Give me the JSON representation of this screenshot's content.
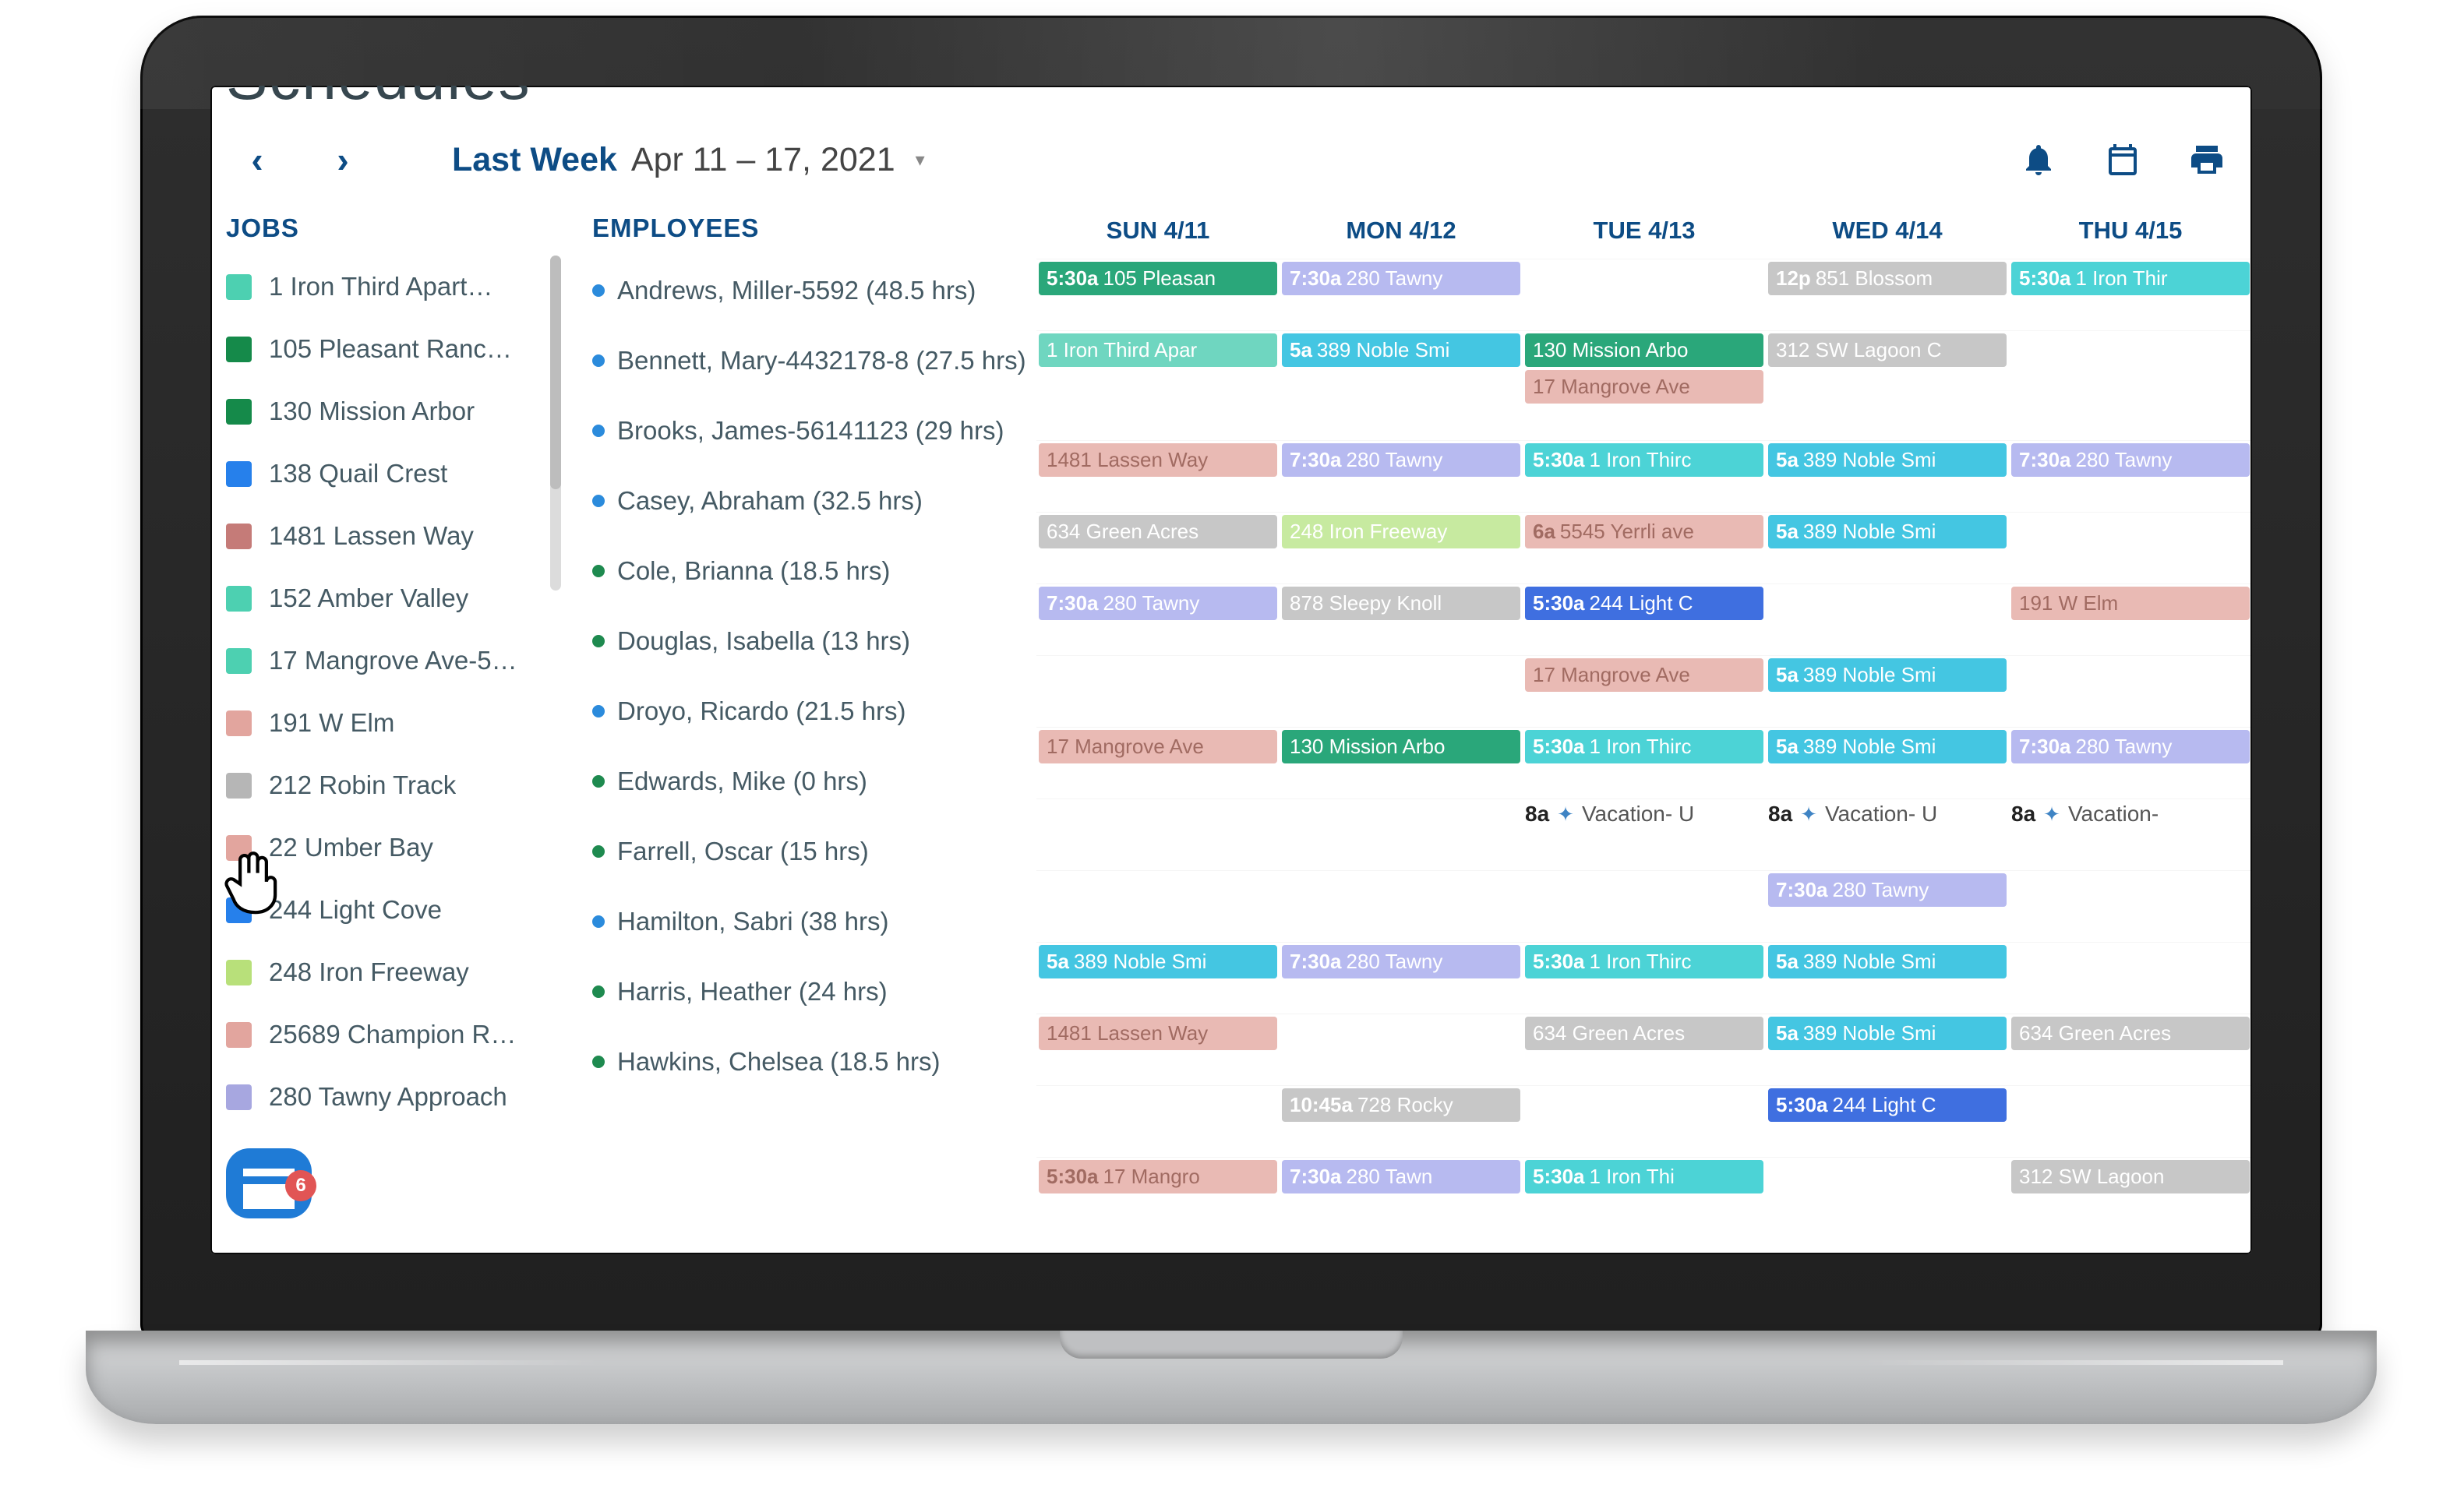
{
  "page": {
    "title": "Schedules"
  },
  "toolbar": {
    "range_label": "Last Week",
    "date_range": "Apr 11 – 17, 2021"
  },
  "day_headers": [
    "SUN 4/11",
    "MON 4/12",
    "TUE 4/13",
    "WED 4/14",
    "THU 4/15"
  ],
  "sections": {
    "jobs": "JOBS",
    "employees": "EMPLOYEES"
  },
  "jobs": [
    {
      "color": "#4dd0b1",
      "name": "1 Iron Third Apart…"
    },
    {
      "color": "#158a4a",
      "name": "105 Pleasant Ranc…"
    },
    {
      "color": "#158a4a",
      "name": "130 Mission Arbor"
    },
    {
      "color": "#2680eb",
      "name": "138 Quail Crest"
    },
    {
      "color": "#c57b78",
      "name": "1481 Lassen Way"
    },
    {
      "color": "#4dd0b1",
      "name": "152 Amber Valley"
    },
    {
      "color": "#4dd0b1",
      "name": "17 Mangrove Ave-5…"
    },
    {
      "color": "#e2a59e",
      "name": "191 W Elm"
    },
    {
      "color": "#b6b6b6",
      "name": "212 Robin Track"
    },
    {
      "color": "#e2a59e",
      "name": "22 Umber Bay"
    },
    {
      "color": "#2680eb",
      "name": "244 Light Cove"
    },
    {
      "color": "#b8e07a",
      "name": "248 Iron Freeway"
    },
    {
      "color": "#e2a59e",
      "name": "25689 Champion R…"
    },
    {
      "color": "#a7a7e0",
      "name": "280 Tawny Approach"
    }
  ],
  "employees": [
    {
      "dot": "#2b8bdc",
      "name": "Andrews, Miller-5592 (48.5 hrs)"
    },
    {
      "dot": "#2b8bdc",
      "name": "Bennett, Mary-4432178-8 (27.5 hrs)"
    },
    {
      "dot": "#2b8bdc",
      "name": "Brooks, James-56141123 (29 hrs)"
    },
    {
      "dot": "#2b8bdc",
      "name": "Casey, Abraham (32.5 hrs)"
    },
    {
      "dot": "#1e8a4f",
      "name": "Cole, Brianna (18.5 hrs)"
    },
    {
      "dot": "#1e8a4f",
      "name": "Douglas, Isabella (13 hrs)"
    },
    {
      "dot": "#2b8bdc",
      "name": "Droyo, Ricardo (21.5 hrs)"
    },
    {
      "dot": "#1e8a4f",
      "name": "Edwards, Mike (0 hrs)"
    },
    {
      "dot": "#1e8a4f",
      "name": "Farrell, Oscar (15 hrs)"
    },
    {
      "dot": "#2b8bdc",
      "name": "Hamilton, Sabri (38 hrs)"
    },
    {
      "dot": "#1e8a4f",
      "name": "Harris, Heather (24 hrs)"
    },
    {
      "dot": "#1e8a4f",
      "name": "Hawkins, Chelsea (18.5 hrs)"
    }
  ],
  "rows": [
    {
      "tall": false,
      "cells": [
        [
          {
            "bg": "#2aa77a",
            "fg": "#ffffff",
            "time": "5:30a",
            "label": "105 Pleasan"
          }
        ],
        [
          {
            "bg": "#b7baf0",
            "fg": "#ffffff",
            "time": "7:30a",
            "label": "280 Tawny"
          }
        ],
        [],
        [
          {
            "bg": "#c7c7c7",
            "fg": "#ffffff",
            "time": "12p",
            "label": "851 Blossom"
          }
        ],
        [
          {
            "bg": "#4cd3d6",
            "fg": "#ffffff",
            "time": "5:30a",
            "label": "1 Iron Thir"
          }
        ]
      ]
    },
    {
      "tall": true,
      "cells": [
        [
          {
            "bg": "#6fd6c0",
            "fg": "#ffffff",
            "time": "",
            "label": "1 Iron Third Apar"
          }
        ],
        [
          {
            "bg": "#44c6e2",
            "fg": "#ffffff",
            "time": "5a",
            "label": "389 Noble Smi"
          }
        ],
        [
          {
            "bg": "#2aa77a",
            "fg": "#ffffff",
            "time": "",
            "label": "130 Mission Arbo"
          },
          {
            "bg": "#e9bab4",
            "fg": "#a16b62",
            "time": "",
            "label": "17 Mangrove Ave"
          }
        ],
        [
          {
            "bg": "#c7c7c7",
            "fg": "#ffffff",
            "time": "",
            "label": "312 SW Lagoon C"
          }
        ],
        []
      ]
    },
    {
      "tall": false,
      "cells": [
        [
          {
            "bg": "#e9bab4",
            "fg": "#a16b62",
            "time": "",
            "label": "1481 Lassen Way"
          }
        ],
        [
          {
            "bg": "#b7baf0",
            "fg": "#ffffff",
            "time": "7:30a",
            "label": "280 Tawny"
          }
        ],
        [
          {
            "bg": "#4cd3d6",
            "fg": "#ffffff",
            "time": "5:30a",
            "label": "1 Iron Thirc"
          }
        ],
        [
          {
            "bg": "#44c6e2",
            "fg": "#ffffff",
            "time": "5a",
            "label": "389 Noble Smi"
          }
        ],
        [
          {
            "bg": "#b7baf0",
            "fg": "#ffffff",
            "time": "7:30a",
            "label": "280 Tawny"
          }
        ]
      ]
    },
    {
      "tall": false,
      "cells": [
        [
          {
            "bg": "#c7c7c7",
            "fg": "#ffffff",
            "time": "",
            "label": "634 Green Acres"
          }
        ],
        [
          {
            "bg": "#c7eaa0",
            "fg": "#ffffff",
            "time": "",
            "label": "248 Iron Freeway"
          }
        ],
        [
          {
            "bg": "#e9bab4",
            "fg": "#a16b62",
            "time": "6a",
            "label": "5545 Yerrli ave"
          }
        ],
        [
          {
            "bg": "#44c6e2",
            "fg": "#ffffff",
            "time": "5a",
            "label": "389 Noble Smi"
          }
        ],
        []
      ]
    },
    {
      "tall": false,
      "cells": [
        [
          {
            "bg": "#b7baf0",
            "fg": "#ffffff",
            "time": "7:30a",
            "label": "280 Tawny"
          }
        ],
        [
          {
            "bg": "#c7c7c7",
            "fg": "#ffffff",
            "time": "",
            "label": "878 Sleepy Knoll"
          }
        ],
        [
          {
            "bg": "#3f6fe0",
            "fg": "#ffffff",
            "time": "5:30a",
            "label": "244 Light C"
          }
        ],
        [],
        [
          {
            "bg": "#e9bab4",
            "fg": "#a16b62",
            "time": "",
            "label": "191 W Elm"
          }
        ]
      ]
    },
    {
      "tall": false,
      "cells": [
        [],
        [],
        [
          {
            "bg": "#e9bab4",
            "fg": "#a16b62",
            "time": "",
            "label": "17 Mangrove Ave"
          }
        ],
        [
          {
            "bg": "#44c6e2",
            "fg": "#ffffff",
            "time": "5a",
            "label": "389 Noble Smi"
          }
        ],
        []
      ]
    },
    {
      "tall": false,
      "cells": [
        [
          {
            "bg": "#e9bab4",
            "fg": "#a16b62",
            "time": "",
            "label": "17 Mangrove Ave"
          }
        ],
        [
          {
            "bg": "#2aa77a",
            "fg": "#ffffff",
            "time": "",
            "label": "130 Mission Arbo"
          }
        ],
        [
          {
            "bg": "#4cd3d6",
            "fg": "#ffffff",
            "time": "5:30a",
            "label": "1 Iron Thirc"
          }
        ],
        [
          {
            "bg": "#44c6e2",
            "fg": "#ffffff",
            "time": "5a",
            "label": "389 Noble Smi"
          }
        ],
        [
          {
            "bg": "#b7baf0",
            "fg": "#ffffff",
            "time": "7:30a",
            "label": "280 Tawny"
          }
        ]
      ]
    },
    {
      "tall": false,
      "vacation": true,
      "cells": [
        [],
        [],
        [
          {
            "vac": true,
            "time": "8a",
            "label": "Vacation- U"
          }
        ],
        [
          {
            "vac": true,
            "time": "8a",
            "label": "Vacation- U"
          }
        ],
        [
          {
            "vac": true,
            "time": "8a",
            "label": "Vacation-"
          }
        ]
      ]
    },
    {
      "tall": false,
      "cells": [
        [],
        [],
        [],
        [
          {
            "bg": "#b7baf0",
            "fg": "#ffffff",
            "time": "7:30a",
            "label": "280 Tawny"
          }
        ],
        []
      ]
    },
    {
      "tall": false,
      "cells": [
        [
          {
            "bg": "#44c6e2",
            "fg": "#ffffff",
            "time": "5a",
            "label": "389 Noble Smi"
          }
        ],
        [
          {
            "bg": "#b7baf0",
            "fg": "#ffffff",
            "time": "7:30a",
            "label": "280 Tawny"
          }
        ],
        [
          {
            "bg": "#4cd3d6",
            "fg": "#ffffff",
            "time": "5:30a",
            "label": "1 Iron Thirc"
          }
        ],
        [
          {
            "bg": "#44c6e2",
            "fg": "#ffffff",
            "time": "5a",
            "label": "389 Noble Smi"
          }
        ],
        []
      ]
    },
    {
      "tall": false,
      "cells": [
        [
          {
            "bg": "#e9bab4",
            "fg": "#a16b62",
            "time": "",
            "label": "1481 Lassen Way"
          }
        ],
        [],
        [
          {
            "bg": "#c7c7c7",
            "fg": "#ffffff",
            "time": "",
            "label": "634 Green Acres"
          }
        ],
        [
          {
            "bg": "#44c6e2",
            "fg": "#ffffff",
            "time": "5a",
            "label": "389 Noble Smi"
          }
        ],
        [
          {
            "bg": "#c7c7c7",
            "fg": "#ffffff",
            "time": "",
            "label": "634 Green Acres"
          }
        ]
      ]
    },
    {
      "tall": false,
      "cells": [
        [],
        [
          {
            "bg": "#c7c7c7",
            "fg": "#ffffff",
            "time": "10:45a",
            "label": "728 Rocky"
          }
        ],
        [],
        [
          {
            "bg": "#3f6fe0",
            "fg": "#ffffff",
            "time": "5:30a",
            "label": "244 Light C"
          }
        ],
        []
      ]
    },
    {
      "tall": false,
      "cells": [
        [
          {
            "bg": "#e9bab4",
            "fg": "#a16b62",
            "time": "5:30a",
            "label": "17 Mangro"
          }
        ],
        [
          {
            "bg": "#b7baf0",
            "fg": "#ffffff",
            "time": "7:30a",
            "label": "280 Tawn"
          }
        ],
        [
          {
            "bg": "#4cd3d6",
            "fg": "#ffffff",
            "time": "5:30a",
            "label": "1 Iron Thi"
          }
        ],
        [],
        [
          {
            "bg": "#c7c7c7",
            "fg": "#ffffff",
            "time": "",
            "label": "312 SW Lagoon"
          }
        ]
      ]
    }
  ],
  "chat_badge": "6"
}
